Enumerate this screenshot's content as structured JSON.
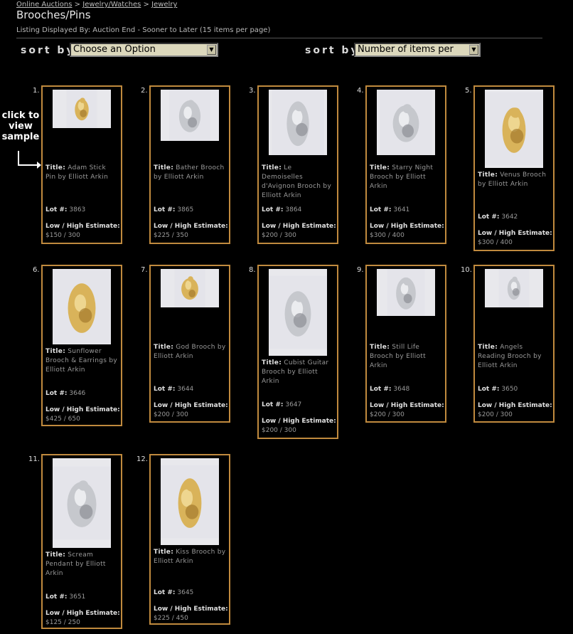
{
  "breadcrumb": [
    "Online Auctions",
    "Jewelry/Watches",
    "Jewelry"
  ],
  "breadcrumb_sep": ">",
  "title": "Brooches/Pins",
  "listing_info": "Listing Displayed By: Auction End - Sooner to Later  (15 items per page)",
  "sort1": {
    "label": "sort by",
    "value": "Choose an Option"
  },
  "sort2": {
    "label": "sort by",
    "value": "Number of items per page"
  },
  "click_hint": "click to view sample",
  "labels": {
    "title": "Title:",
    "lot": "Lot #:",
    "estimate": "Low / High Estimate:"
  },
  "colors": {
    "border": "#c08a3e",
    "background": "#000000"
  },
  "items": [
    {
      "num": "1.",
      "title": "Adam Stick Pin by Elliott Arkin",
      "lot": "3863",
      "estimate": "$150 / 300",
      "metal": "gold"
    },
    {
      "num": "2.",
      "title": "Bather Brooch by Elliott Arkin",
      "lot": "3865",
      "estimate": "$225 / 350",
      "metal": "silver"
    },
    {
      "num": "3.",
      "title": "Le Demoiselles d'Avignon Brooch by Elliott Arkin",
      "lot": "3864",
      "estimate": "$200 / 300",
      "metal": "silver"
    },
    {
      "num": "4.",
      "title": "Starry Night Brooch by Elliott Arkin",
      "lot": "3641",
      "estimate": "$300 / 400",
      "metal": "silver"
    },
    {
      "num": "5.",
      "title": "Venus Brooch by Elliott Arkin",
      "lot": "3642",
      "estimate": "$300 / 400",
      "metal": "gold"
    },
    {
      "num": "6.",
      "title": "Sunflower Brooch & Earrings by Elliott Arkin",
      "lot": "3646",
      "estimate": "$425 / 650",
      "metal": "gold"
    },
    {
      "num": "7.",
      "title": "God Brooch by Elliott Arkin",
      "lot": "3644",
      "estimate": "$200 / 300",
      "metal": "gold"
    },
    {
      "num": "8.",
      "title": "Cubist Guitar Brooch by Elliott Arkin",
      "lot": "3647",
      "estimate": "$200 / 300",
      "metal": "silver"
    },
    {
      "num": "9.",
      "title": "Still Life Brooch by Elliott Arkin",
      "lot": "3648",
      "estimate": "$200 / 300",
      "metal": "silver"
    },
    {
      "num": "10.",
      "title": "Angels Reading Brooch by Elliott Arkin",
      "lot": "3650",
      "estimate": "$200 / 300",
      "metal": "silver"
    },
    {
      "num": "11.",
      "title": "Scream Pendant by Elliott Arkin",
      "lot": "3651",
      "estimate": "$125 / 250",
      "metal": "silver"
    },
    {
      "num": "12.",
      "title": "Kiss Brooch by Elliott Arkin",
      "lot": "3645",
      "estimate": "$225 / 450",
      "metal": "gold"
    }
  ]
}
